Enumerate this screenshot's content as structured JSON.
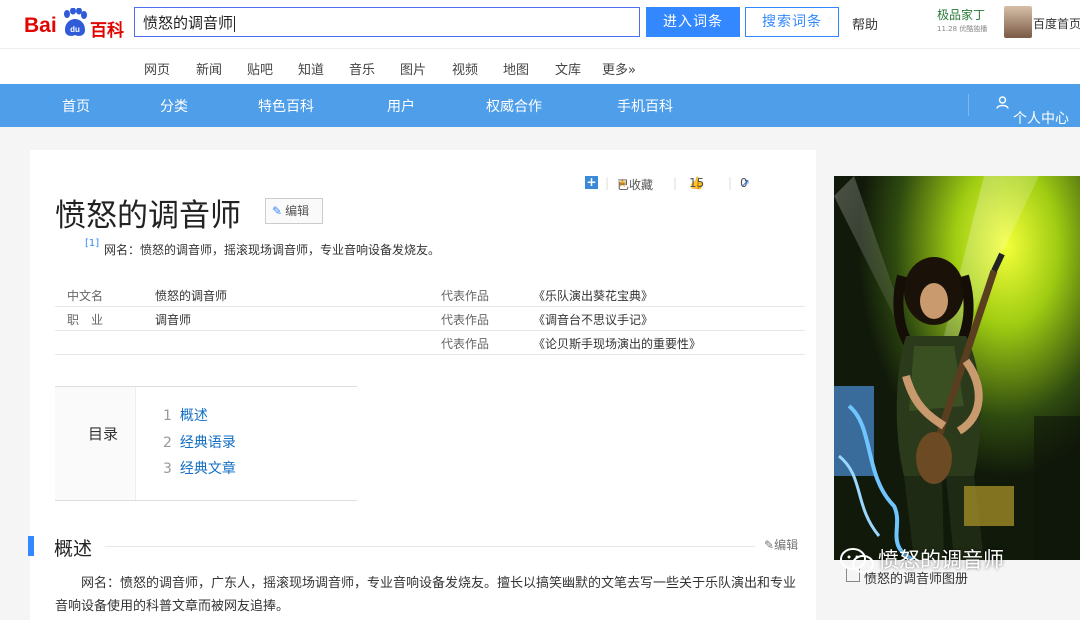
{
  "header": {
    "logo": {
      "part1": "Bai",
      "part2": "du",
      "part3": "百科"
    },
    "search_value": "愤怒的调音师",
    "enter_button": "进入词条",
    "search_button": "搜索词条",
    "help": "帮助",
    "promo_title": "极品家丁",
    "promo_sub": "11.28 优酷独播",
    "baidu_home": "百度首页"
  },
  "subnav": [
    "网页",
    "新闻",
    "贴吧",
    "知道",
    "音乐",
    "图片",
    "视频",
    "地图",
    "文库",
    "更多»"
  ],
  "mainnav": [
    "首页",
    "分类",
    "特色百科",
    "用户",
    "权威合作",
    "手机百科"
  ],
  "user_center": "个人中心",
  "actions": {
    "favorited": "已收藏",
    "likes": "15",
    "shares": "0"
  },
  "article": {
    "title": "愤怒的调音师",
    "edit": "编辑",
    "ref": "[1]",
    "summary": "网名：愤怒的调音师，摇滚现场调音师，专业音响设备发烧友。",
    "info": {
      "name_key": "中文名",
      "name_val": "愤怒的调音师",
      "job_key": "职　业",
      "job_val": "调音师",
      "works_key": "代表作品",
      "works": [
        "《乐队演出葵花宝典》",
        "《调音台不思议手记》",
        "《论贝斯手现场演出的重要性》"
      ]
    },
    "toc": {
      "label": "目录",
      "items": [
        {
          "num": "1",
          "text": "概述"
        },
        {
          "num": "2",
          "text": "经典语录"
        },
        {
          "num": "3",
          "text": "经典文章"
        }
      ]
    },
    "section_title": "概述",
    "section_edit": "编辑",
    "paragraph": "网名：愤怒的调音师，广东人，摇滚现场调音师，专业音响设备发烧友。擅长以搞笑幽默的文笔去写一些关于乐队演出和专业音响设备使用的科普文章而被网友追捧。"
  },
  "photo_caption": "愤怒的调音师图册",
  "watermark": "愤怒的调音师",
  "colors": {
    "brand_red": "#e10602",
    "accent_blue": "#3388ff",
    "nav_blue": "#4e9eea"
  }
}
